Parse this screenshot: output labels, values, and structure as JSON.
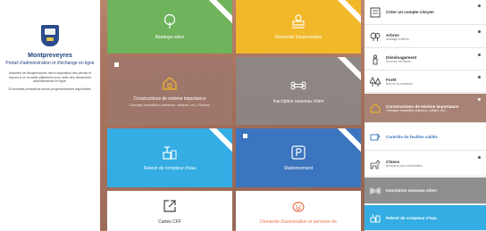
{
  "left": {
    "title": "Montpreveyres",
    "subtitle": "Portail d'administration et d'échange en ligne",
    "para1": "Autorités de Montpreveyres met à disposition des permis et répond à un nouvelle plateforme pour aider des démarches administratives en ligne.",
    "para2": "D'nouvelles prestations seront progressivement disponibles."
  },
  "tiles": [
    {
      "label": "Abattage arbre",
      "icon": "tree-icon"
    },
    {
      "label": "Demande d'autorisation",
      "icon": "stamp-icon"
    },
    {
      "label": "Constructions de minime importance",
      "sub": "Ouvrages immobiliers (cabanons, cabanes, etc.), Piscines",
      "icon": "house-icon"
    },
    {
      "label": "Inscription nouveau chien",
      "icon": "bone-icon"
    },
    {
      "label": "Relevé de compteur d'eau",
      "icon": "water-meter-icon"
    },
    {
      "label": "Stationnement",
      "icon": "parking-icon"
    },
    {
      "label": "Cartes CFF",
      "icon": "external-link-icon"
    },
    {
      "label": "Demande d'autorisation et annonce de",
      "icon": "pig-icon"
    }
  ],
  "menu": [
    {
      "title": "Créer un compte citoyen",
      "icon": "account-icon"
    },
    {
      "title": "Arbres",
      "sub": "Abattage d'arbres",
      "icon": "trees-icon"
    },
    {
      "title": "Déménagement",
      "sub": "Annonce de départ",
      "icon": "moving-icon"
    },
    {
      "title": "Forêt",
      "sub": "Bois de la commune",
      "icon": "forest-icon"
    },
    {
      "title": "Constructions de minime importance",
      "sub": "Ouvrages immobiliers (cabanon, cabane, etc.)",
      "icon": "house-icon"
    },
    {
      "title": "Contrôle de feuilles vaillés",
      "icon": "leaf-icon"
    },
    {
      "title": "Chiens",
      "sub": "Annonces pour nos familles",
      "icon": "dog-icon"
    },
    {
      "title": "Inscription nouveau chien",
      "icon": "bone-icon"
    },
    {
      "title": "Relevé de compteur d'eau",
      "icon": "water-meter-icon"
    }
  ],
  "colors": {
    "green": "#6fb35c",
    "yellow": "#f1b829",
    "brown": "#a88274",
    "gray": "#8e8e8e",
    "lightblue": "#33ade3",
    "blue": "#3c75bf",
    "navy": "#1f3f7a"
  }
}
